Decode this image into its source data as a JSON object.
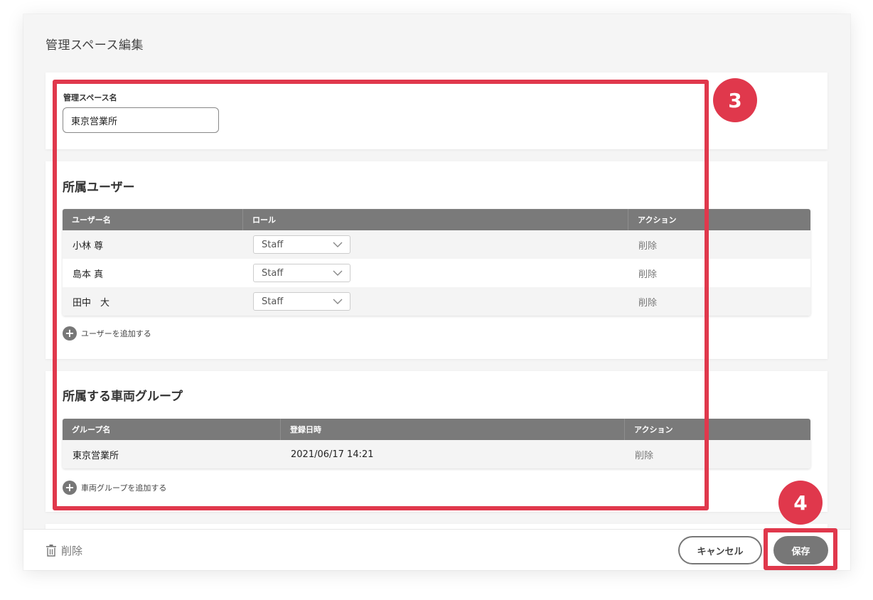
{
  "page": {
    "title": "管理スペース編集"
  },
  "name_section": {
    "label": "管理スペース名",
    "value": "東京営業所"
  },
  "users_section": {
    "title": "所属ユーザー",
    "columns": [
      "ユーザー名",
      "ロール",
      "アクション"
    ],
    "rows": [
      {
        "name": "小林 尊",
        "role": "Staff",
        "action": "削除"
      },
      {
        "name": "島本 真",
        "role": "Staff",
        "action": "削除"
      },
      {
        "name": "田中　大",
        "role": "Staff",
        "action": "削除"
      }
    ],
    "add_label": "ユーザーを追加する"
  },
  "groups_section": {
    "title": "所属する車両グループ",
    "columns": [
      "グループ名",
      "登録日時",
      "アクション"
    ],
    "rows": [
      {
        "name": "東京営業所",
        "registered": "2021/06/17 14:21",
        "action": "削除"
      }
    ],
    "add_label": "車両グループを追加する"
  },
  "footer": {
    "delete_label": "削除",
    "cancel_label": "キャンセル",
    "save_label": "保存"
  },
  "annotations": {
    "badge3": "3",
    "badge4": "4"
  },
  "colors": {
    "highlight": "#e0384c",
    "header_bg": "#7a7a7a",
    "button_gray": "#777777"
  }
}
